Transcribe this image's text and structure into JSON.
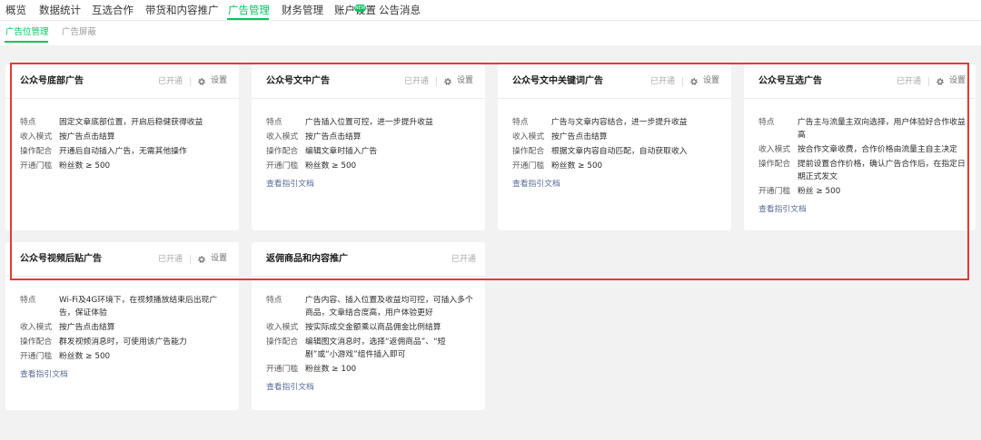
{
  "nav": {
    "tabs": [
      {
        "label": "概览"
      },
      {
        "label": "数据统计"
      },
      {
        "label": "互选合作"
      },
      {
        "label": "带货和内容推广"
      },
      {
        "label": "广告管理"
      },
      {
        "label": "财务管理"
      },
      {
        "label": "账户设置"
      },
      {
        "label": "公告消息"
      }
    ],
    "active_tab": "广告管理",
    "badge": "NEW"
  },
  "subnav": {
    "tabs": [
      {
        "label": "广告位管理"
      },
      {
        "label": "广告屏蔽"
      }
    ],
    "active_tab": "广告位管理"
  },
  "labels": {
    "feature": "特点",
    "income": "收入模式",
    "operation": "操作配合",
    "threshold": "开通门槛"
  },
  "cards": [
    {
      "title": "公众号底部广告",
      "status": "已开通",
      "setting": "设置",
      "feature": "固定文章底部位置，开启后稳健获得收益",
      "income": "按广告点击结算",
      "operation": "开通后自动插入广告，无需其他操作",
      "threshold": "粉丝数 ≥ 500"
    },
    {
      "title": "公众号文中广告",
      "status": "已开通",
      "setting": "设置",
      "feature": "广告插入位置可控，进一步提升收益",
      "income": "按广告点击结算",
      "operation": "编辑文章时插入广告",
      "threshold": "粉丝数 ≥ 500",
      "link": "查看指引文档"
    },
    {
      "title": "公众号文中关键词广告",
      "status": "已开通",
      "setting": "设置",
      "feature": "广告与文章内容结合，进一步提升收益",
      "income": "按广告点击结算",
      "operation": "根据文章内容自动匹配，自动获取收入",
      "threshold": "粉丝数 ≥ 500",
      "link": "查看指引文档"
    },
    {
      "title": "公众号互选广告",
      "status": "已开通",
      "setting": "设置",
      "feature": "广告主与流量主双向选择，用户体验好合作收益高",
      "income": "按合作文章收费，合作价格由流量主自主决定",
      "operation": "提前设置合作价格，确认广告合作后，在指定日期正式发文",
      "threshold": "粉丝 ≥ 500",
      "link": "查看指引文档"
    },
    {
      "title": "公众号视频后贴广告",
      "status": "已开通",
      "setting": "设置",
      "feature": "Wi-Fi及4G环境下，在视频播放结束后出现广告，保证体验",
      "income": "按广告点击结算",
      "operation": "群发视频消息时，可使用该广告能力",
      "threshold": "粉丝数 ≥ 500",
      "link": "查看指引文档"
    },
    {
      "title": "返佣商品和内容推广",
      "status": "已开通",
      "feature": "广告内容、插入位置及收益均可控，可插入多个商品，文章结合度高，用户体验更好",
      "income": "按实际成交金额乘以商品佣金比例结算",
      "operation": "编辑图文消息时，选择“返佣商品”、“短剧”或“小游戏”组件插入即可",
      "threshold": "粉丝数 ≥ 100",
      "link": "查看指引文档"
    }
  ],
  "colors": {
    "accent": "#07c160",
    "link": "#576b95",
    "highlight": "#e53935"
  }
}
